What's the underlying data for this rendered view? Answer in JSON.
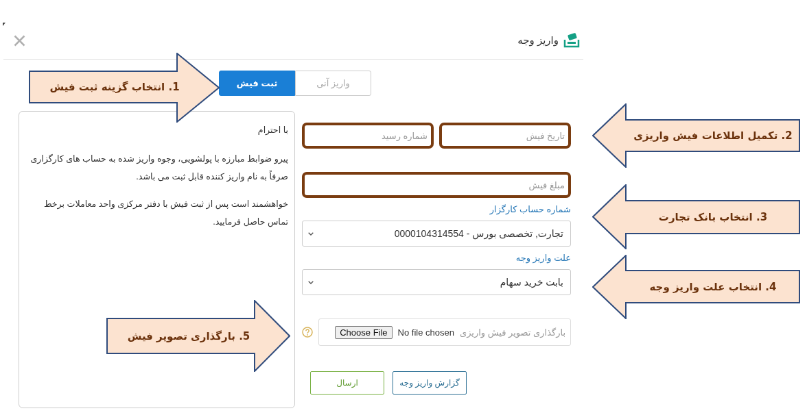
{
  "dialog": {
    "title": "واریز وجه"
  },
  "mode_tabs": [
    {
      "label": "واریز آنی",
      "selected": false
    },
    {
      "label": "ثبت فیش",
      "selected": true
    }
  ],
  "notice": {
    "greeting": "با احترام",
    "paragraphs": [
      "پیرو ضوابط مبارزه با پولشویی، وجوه واریز شده به حساب های کارگزاری صرفاً به نام واریز کننده قابل ثبت می باشد.",
      "خواهشمند است پس از ثبت فیش با دفتر مرکزی واحد معاملات برخط تماس حاصل فرمایید."
    ]
  },
  "form": {
    "receipt_fields": [
      {
        "placeholder": "تاریخ فیش",
        "highlighted": true
      },
      {
        "placeholder": "شماره رسید",
        "highlighted": true
      }
    ],
    "amount_field": {
      "placeholder": "مبلغ فیش",
      "highlighted": true
    },
    "broker_account": {
      "label": "شماره حساب کارگزار",
      "value": "تجارت, تخصصی بورس - 0000104314554"
    },
    "deposit_reason": {
      "label": "علت واریز وجه",
      "value": "بابت خرید سهام"
    },
    "upload": {
      "caption": "بارگذاری تصویر فیش واریزی",
      "status": "No file chosen",
      "button": "Choose File"
    },
    "buttons": [
      {
        "label": "گزارش واریز وجه",
        "kind": "report"
      },
      {
        "label": "ارسال",
        "kind": "submit"
      }
    ]
  },
  "annotations": [
    {
      "label": "1. انتخاب گزینه ثبت فیش",
      "kind": "right"
    },
    {
      "label": "2. تکمیل اطلاعات فیش واریزی",
      "kind": "left"
    },
    {
      "label": "3. انتخاب بانک تجارت",
      "kind": "left"
    },
    {
      "label": "4. انتخاب علت واریز وجه",
      "kind": "left"
    },
    {
      "label": "5. بارگذاری تصویر فیش",
      "kind": "right"
    }
  ]
}
